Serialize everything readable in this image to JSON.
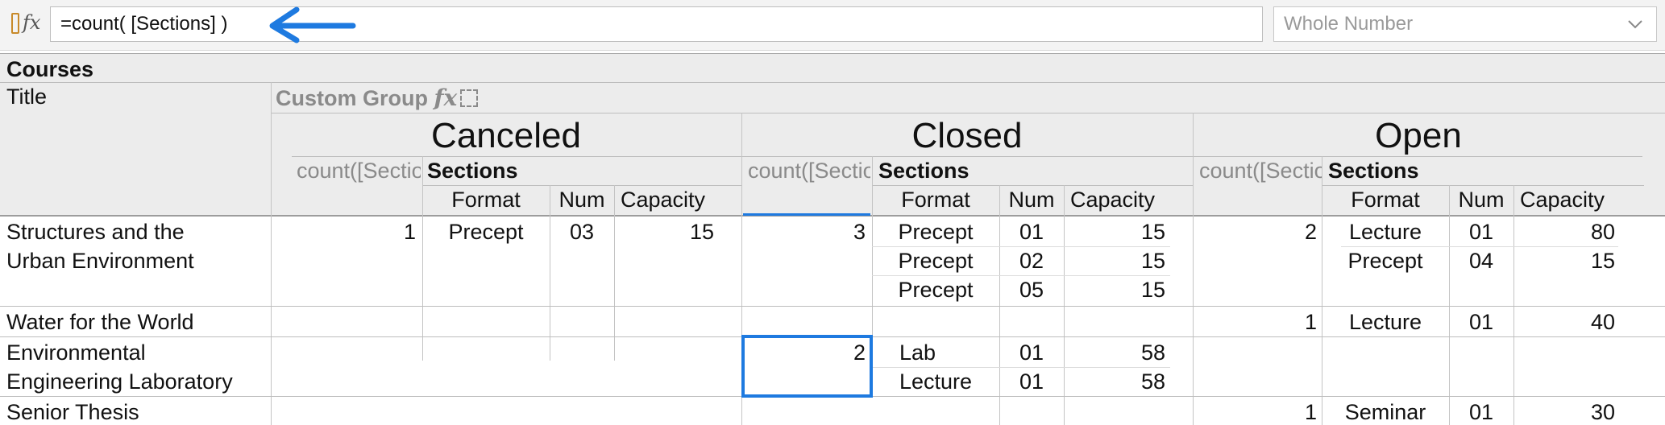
{
  "formula_bar": {
    "formula": "=count( [Sections] )",
    "type_select": "Whole Number",
    "accent_color": "#1e7ae0"
  },
  "table": {
    "title": "Courses",
    "title_col": "Title",
    "custom_group": "Custom Group",
    "groups": [
      "Canceled",
      "Closed",
      "Open"
    ],
    "count_header": "count([Sections])",
    "sections_header": "Sections",
    "sub_headers": [
      "Format",
      "Num",
      "Capacity"
    ],
    "rows": [
      {
        "title": [
          "Structures and the",
          "Urban Environment"
        ],
        "canceled": {
          "count": "1",
          "sections": [
            [
              "Precept",
              "03",
              "15"
            ]
          ]
        },
        "closed": {
          "count": "3",
          "sections": [
            [
              "Precept",
              "01",
              "15"
            ],
            [
              "Precept",
              "02",
              "15"
            ],
            [
              "Precept",
              "05",
              "15"
            ]
          ]
        },
        "open": {
          "count": "2",
          "sections": [
            [
              "Lecture",
              "01",
              "80"
            ],
            [
              "Precept",
              "04",
              "15"
            ]
          ]
        }
      },
      {
        "title": [
          "Water for the World"
        ],
        "open": {
          "count": "1",
          "sections": [
            [
              "Lecture",
              "01",
              "40"
            ]
          ]
        }
      },
      {
        "title": [
          "Environmental",
          "Engineering Laboratory"
        ],
        "closed": {
          "count": "2",
          "sections": [
            [
              "Lab",
              "01",
              "58"
            ],
            [
              "Lecture",
              "01",
              "58"
            ]
          ]
        }
      },
      {
        "title": [
          "Senior Thesis"
        ],
        "open": {
          "count": "1",
          "sections": [
            [
              "Seminar",
              "01",
              "30"
            ]
          ]
        }
      }
    ]
  }
}
